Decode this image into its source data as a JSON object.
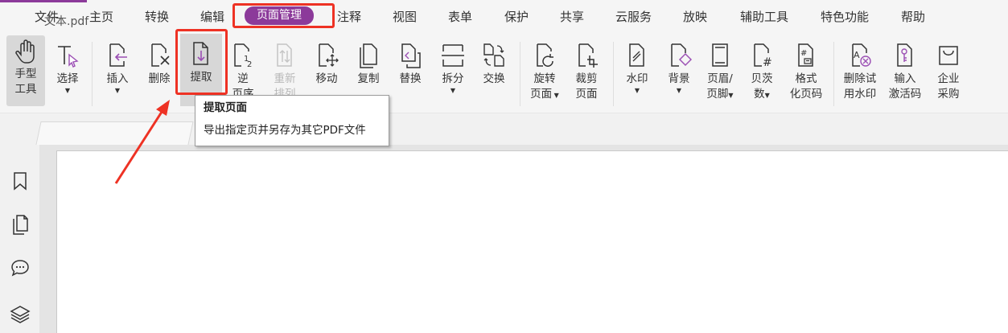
{
  "menu": {
    "items": [
      {
        "label": "文件"
      },
      {
        "label": "主页"
      },
      {
        "label": "转换"
      },
      {
        "label": "编辑"
      },
      {
        "label": "页面管理"
      },
      {
        "label": "注释"
      },
      {
        "label": "视图"
      },
      {
        "label": "表单"
      },
      {
        "label": "保护"
      },
      {
        "label": "共享"
      },
      {
        "label": "云服务"
      },
      {
        "label": "放映"
      },
      {
        "label": "辅助工具"
      },
      {
        "label": "特色功能"
      },
      {
        "label": "帮助"
      }
    ],
    "active": "页面管理"
  },
  "ribbon": {
    "tools": [
      {
        "line1": "手型",
        "line2": "工具",
        "icon": "hand-icon"
      },
      {
        "line1": "选择",
        "line2": "",
        "icon": "select-text-icon"
      },
      {
        "line1": "插入",
        "line2": "",
        "icon": "insert-page-icon"
      },
      {
        "line1": "删除",
        "line2": "",
        "icon": "delete-page-icon"
      },
      {
        "line1": "提取",
        "line2": "",
        "icon": "extract-page-icon"
      },
      {
        "line1": "逆",
        "line2": "页序",
        "icon": "reverse-order-icon"
      },
      {
        "line1": "重新",
        "line2": "排列",
        "icon": "rearrange-icon"
      },
      {
        "line1": "移动",
        "line2": "",
        "icon": "move-page-icon"
      },
      {
        "line1": "复制",
        "line2": "",
        "icon": "copy-page-icon"
      },
      {
        "line1": "替换",
        "line2": "",
        "icon": "replace-page-icon"
      },
      {
        "line1": "拆分",
        "line2": "",
        "icon": "split-icon"
      },
      {
        "line1": "交换",
        "line2": "",
        "icon": "swap-icon"
      },
      {
        "line1": "旋转",
        "line2": "页面",
        "icon": "rotate-page-icon"
      },
      {
        "line1": "裁剪",
        "line2": "页面",
        "icon": "crop-page-icon"
      },
      {
        "line1": "水印",
        "line2": "",
        "icon": "watermark-icon"
      },
      {
        "line1": "背景",
        "line2": "",
        "icon": "background-icon"
      },
      {
        "line1": "页眉/",
        "line2": "页脚",
        "icon": "header-footer-icon"
      },
      {
        "line1": "贝茨",
        "line2": "数",
        "icon": "bates-number-icon"
      },
      {
        "line1": "格式",
        "line2": "化页码",
        "icon": "format-page-number-icon"
      },
      {
        "line1": "删除试",
        "line2": "用水印",
        "icon": "remove-trial-watermark-icon"
      },
      {
        "line1": "输入",
        "line2": "激活码",
        "icon": "activation-key-icon"
      },
      {
        "line1": "企业",
        "line2": "采购",
        "icon": "enterprise-purchase-icon"
      }
    ]
  },
  "document": {
    "tab_title": "文本.pdf"
  },
  "tooltip": {
    "title": "提取页面",
    "description": "导出指定页并另存为其它PDF文件"
  },
  "sidebar": {
    "icons": [
      "bookmark-icon",
      "pages-icon",
      "comment-icon",
      "layers-icon"
    ]
  },
  "colors": {
    "accent": "#8c3a9a",
    "highlight": "#ee3224",
    "icon_purple": "#9b4fb4"
  }
}
